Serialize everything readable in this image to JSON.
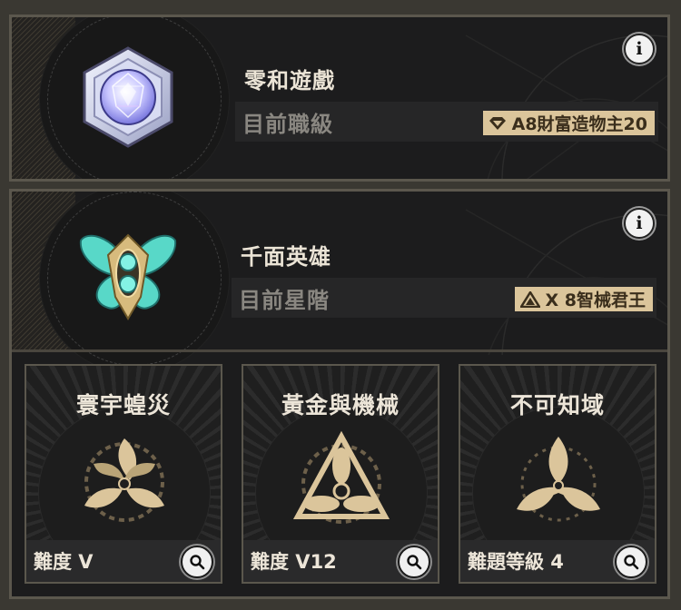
{
  "colors": {
    "gold": "#dbc59b",
    "panel_bg": "#1c1c1d",
    "border": "#5b574d",
    "title_text": "#ebe4d6",
    "muted_text": "#8a8781"
  },
  "panel_top": {
    "title": "零和遊戲",
    "rank_label": "目前職級",
    "badge_text": "A8財富造物主20",
    "badge_icon": "diamond-icon",
    "info_icon": "info-icon"
  },
  "panel_bottom": {
    "title": "千面英雄",
    "rank_label": "目前星階",
    "badge_text": "X 8智械君王",
    "badge_icon": "triangle-emblem-icon",
    "info_icon": "info-icon"
  },
  "cards": [
    {
      "title": "寰宇蝗災",
      "difficulty": "難度 V",
      "emblem": "swarm-emblem-icon",
      "action": "search-icon"
    },
    {
      "title": "黃金與機械",
      "difficulty": "難度 V12",
      "emblem": "gold-machine-emblem-icon",
      "action": "search-icon"
    },
    {
      "title": "不可知域",
      "difficulty": "難題等級 4",
      "emblem": "unknowable-emblem-icon",
      "action": "search-icon"
    }
  ]
}
